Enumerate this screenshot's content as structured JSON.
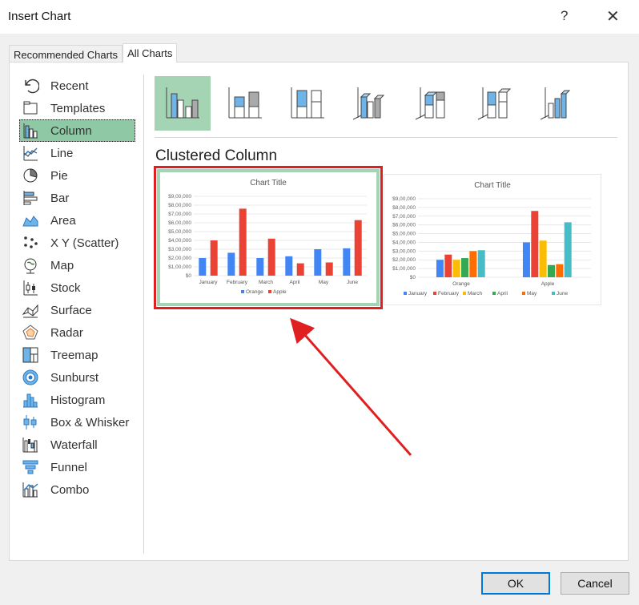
{
  "window": {
    "title": "Insert Chart",
    "help": "?",
    "close": "✕"
  },
  "tabs": [
    {
      "label": "Recommended Charts"
    },
    {
      "label": "All Charts"
    }
  ],
  "sidebar": {
    "items": [
      {
        "label": "Recent",
        "icon": "recent-icon"
      },
      {
        "label": "Templates",
        "icon": "templates-icon"
      },
      {
        "label": "Column",
        "icon": "column-chart-icon"
      },
      {
        "label": "Line",
        "icon": "line-chart-icon"
      },
      {
        "label": "Pie",
        "icon": "pie-chart-icon"
      },
      {
        "label": "Bar",
        "icon": "bar-chart-icon"
      },
      {
        "label": "Area",
        "icon": "area-chart-icon"
      },
      {
        "label": "X Y (Scatter)",
        "icon": "scatter-chart-icon"
      },
      {
        "label": "Map",
        "icon": "map-chart-icon"
      },
      {
        "label": "Stock",
        "icon": "stock-chart-icon"
      },
      {
        "label": "Surface",
        "icon": "surface-chart-icon"
      },
      {
        "label": "Radar",
        "icon": "radar-chart-icon"
      },
      {
        "label": "Treemap",
        "icon": "treemap-chart-icon"
      },
      {
        "label": "Sunburst",
        "icon": "sunburst-chart-icon"
      },
      {
        "label": "Histogram",
        "icon": "histogram-chart-icon"
      },
      {
        "label": "Box & Whisker",
        "icon": "box-whisker-chart-icon"
      },
      {
        "label": "Waterfall",
        "icon": "waterfall-chart-icon"
      },
      {
        "label": "Funnel",
        "icon": "funnel-chart-icon"
      },
      {
        "label": "Combo",
        "icon": "combo-chart-icon"
      }
    ],
    "selected": "Column"
  },
  "subtypes": [
    "clustered-column-icon",
    "stacked-column-icon",
    "100-stacked-column-icon",
    "3d-clustered-column-icon",
    "3d-stacked-column-icon",
    "3d-100-stacked-column-icon",
    "3d-column-icon"
  ],
  "subtype_title": "Clustered Column",
  "colors": {
    "orange_series": "#4285f4",
    "apple_series": "#ea4335",
    "months": [
      "#4285f4",
      "#ea4335",
      "#fbbc04",
      "#34a853",
      "#ff6d01",
      "#46bdc6"
    ],
    "selection_green": "#a4d4b3",
    "highlight_red": "#e02020"
  },
  "chart_data": [
    {
      "type": "bar",
      "title": "Chart Title",
      "categories": [
        "January",
        "February",
        "March",
        "April",
        "May",
        "June"
      ],
      "series": [
        {
          "name": "Orange",
          "values": [
            2000000,
            2600000,
            2000000,
            2200000,
            3000000,
            3100000
          ]
        },
        {
          "name": "Apple",
          "values": [
            4000000,
            7600000,
            4200000,
            1400000,
            1500000,
            6300000
          ]
        }
      ],
      "yticks": [
        "$0",
        "$1,00,000",
        "$2,00,000",
        "$3,00,000",
        "$4,00,000",
        "$5,00,000",
        "$6,00,000",
        "$7,00,000",
        "$8,00,000",
        "$9,00,000"
      ],
      "ylim": [
        0,
        9000000
      ],
      "legend": "bottom"
    },
    {
      "type": "bar",
      "title": "Chart Title",
      "categories": [
        "Orange",
        "Apple"
      ],
      "series": [
        {
          "name": "January",
          "values": [
            2000000,
            4000000
          ]
        },
        {
          "name": "February",
          "values": [
            2600000,
            7600000
          ]
        },
        {
          "name": "March",
          "values": [
            2000000,
            4200000
          ]
        },
        {
          "name": "April",
          "values": [
            2200000,
            1400000
          ]
        },
        {
          "name": "May",
          "values": [
            3000000,
            1500000
          ]
        },
        {
          "name": "June",
          "values": [
            3100000,
            6300000
          ]
        }
      ],
      "yticks": [
        "$0",
        "$1,00,000",
        "$2,00,000",
        "$3,00,000",
        "$4,00,000",
        "$5,00,000",
        "$6,00,000",
        "$7,00,000",
        "$8,00,000",
        "$9,00,000"
      ],
      "ylim": [
        0,
        9000000
      ],
      "legend": "bottom"
    }
  ],
  "buttons": {
    "ok": "OK",
    "cancel": "Cancel"
  }
}
